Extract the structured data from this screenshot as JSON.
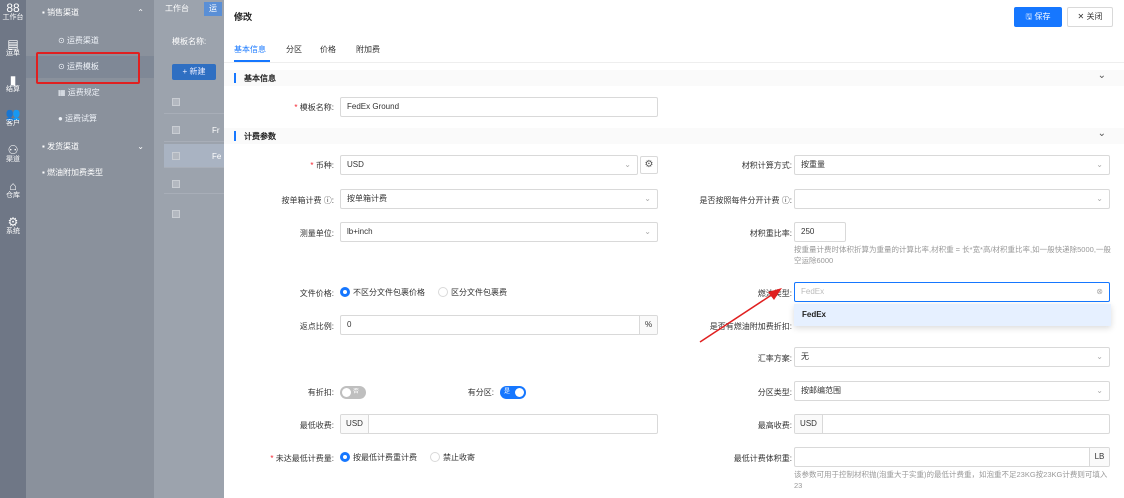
{
  "rail": [
    {
      "icon": "workbench-icon",
      "glyph": "88",
      "label": "工作台"
    },
    {
      "icon": "waybill-icon",
      "glyph": "▤",
      "label": "运单"
    },
    {
      "icon": "settlement-icon",
      "glyph": "▮",
      "label": "结算"
    },
    {
      "icon": "customer-icon",
      "glyph": "👥",
      "label": "客户"
    },
    {
      "icon": "channel-icon",
      "glyph": "⚇",
      "label": "渠道"
    },
    {
      "icon": "warehouse-icon",
      "glyph": "⌂",
      "label": "仓库"
    },
    {
      "icon": "system-icon",
      "glyph": "⚙",
      "label": "系统"
    }
  ],
  "sidebar": {
    "group1": "销售渠道",
    "items": [
      "运费渠道",
      "运费模板",
      "运费规定",
      "运费试算"
    ],
    "group2": "发货渠道",
    "group3": "燃油附加费类型"
  },
  "bg": {
    "tab1": "工作台",
    "tab2": "运",
    "filter_label": "模板名称:",
    "new_button": "+ 新建",
    "row_text1": "Fr",
    "row_text2": "Fe"
  },
  "drawer": {
    "title": "修改",
    "save": "保存",
    "close": "关闭",
    "tabs": [
      "基本信息",
      "分区",
      "价格",
      "附加费"
    ],
    "section_basic": "基本信息",
    "section_fee": "计费参数"
  },
  "form": {
    "template_name_label": "模板名称:",
    "template_name": "FedEx Ground",
    "currency_label": "币种:",
    "currency": "USD",
    "volume_calc_label": "材积计算方式:",
    "volume_calc": "按重量",
    "per_box_label": "按单箱计费",
    "per_box": "按单箱计费",
    "per_piece_label": "是否按照每件分开计费",
    "unit_label": "测量单位:",
    "unit": "lb+inch",
    "volume_ratio_label": "材积重比率:",
    "volume_ratio": "250",
    "volume_hint": "按重量计费时体积折算为重量的计算比率,材积重 = 长*宽*高/材积重比率,如一般快递除5000,一般空运除6000",
    "file_price_label": "文件价格:",
    "file_price_opt1": "不区分文件包裹价格",
    "file_price_opt2": "区分文件包裹费",
    "fuel_type_label": "燃油类型:",
    "fuel_type_placeholder": "FedEx",
    "fuel_option": "FedEx",
    "rebate_label": "返点比例:",
    "rebate": "0",
    "rebate_unit": "%",
    "fuel_discount_label": "是否有燃油附加费折扣:",
    "rate_plan_label": "汇率方案:",
    "rate_plan": "无",
    "discount_label": "有折扣:",
    "discount_switch": "否",
    "has_zone_label": "有分区:",
    "has_zone_switch": "是",
    "zone_type_label": "分区类型:",
    "zone_type": "按邮编范围",
    "min_fee_label": "最低收费:",
    "min_fee_currency": "USD",
    "max_fee_label": "最高收费:",
    "max_fee_currency": "USD",
    "below_min_label": "未达最低计费量:",
    "below_min_opt1": "按最低计费重计费",
    "below_min_opt2": "禁止收寄",
    "min_weight_label": "最低计费体积重:",
    "min_weight_unit": "LB",
    "min_weight_hint": "该参数可用于控制材积抛(泡重大于实重)的最低计费重，如泡重不足23KG按23KG计费则可填入23"
  }
}
